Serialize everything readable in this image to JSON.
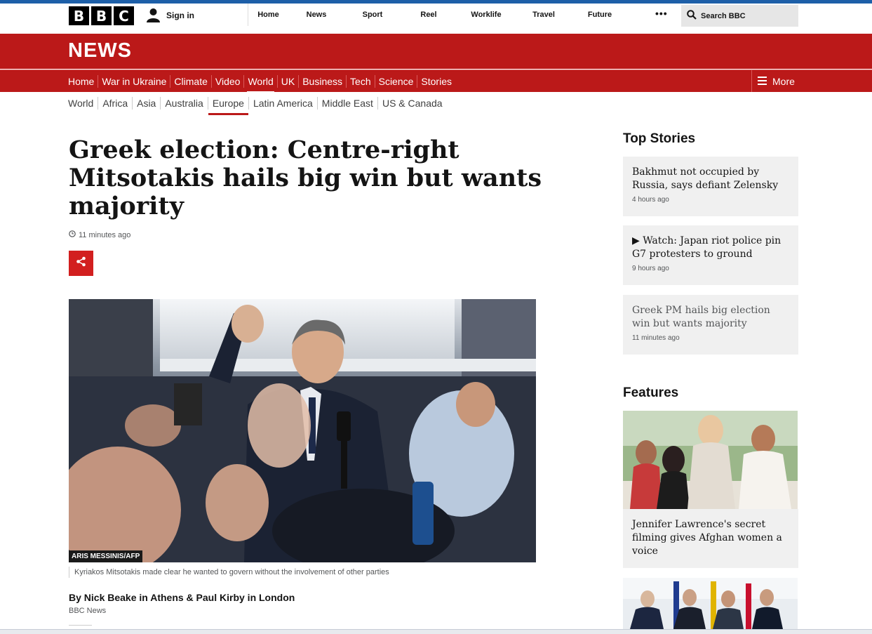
{
  "global": {
    "logo_letters": [
      "B",
      "B",
      "C"
    ],
    "signin_label": "Sign in",
    "nav": [
      "Home",
      "News",
      "Sport",
      "Reel",
      "Worklife",
      "Travel",
      "Future"
    ],
    "more_label": "•••",
    "search_label": "Search BBC"
  },
  "news": {
    "title": "NEWS",
    "nav": [
      "Home",
      "War in Ukraine",
      "Climate",
      "Video",
      "World",
      "UK",
      "Business",
      "Tech",
      "Science",
      "Stories"
    ],
    "active_nav": "World",
    "more_label": "More",
    "subnav": [
      "World",
      "Africa",
      "Asia",
      "Australia",
      "Europe",
      "Latin America",
      "Middle East",
      "US & Canada"
    ],
    "active_subnav": "Europe"
  },
  "article": {
    "headline": "Greek election: Centre-right Mitsotakis hails big win but wants majority",
    "timestamp": "11 minutes ago",
    "image_credit": "ARIS MESSINIS/AFP",
    "caption": "Kyriakos Mitsotakis made clear he wanted to govern without the involvement of other parties",
    "byline": "By Nick Beake in Athens & Paul Kirby in London",
    "byline_org": "BBC News"
  },
  "sidebar": {
    "top_stories_title": "Top Stories",
    "top_stories": [
      {
        "title": "Bakhmut not occupied by Russia, says defiant Zelensky",
        "time": "4 hours ago"
      },
      {
        "title": "▶ Watch: Japan riot police pin G7 protesters to ground",
        "time": "9 hours ago"
      },
      {
        "title": "Greek PM hails big election win but wants majority",
        "time": "11 minutes ago"
      }
    ],
    "features_title": "Features",
    "feature_story": "Jennifer Lawrence's secret filming gives Afghan women a voice"
  },
  "colors": {
    "bbc_red": "#bb1919",
    "share_red": "#d21f1f",
    "top_strip": "#1d5fa8",
    "card_bg": "#f0f0f0"
  }
}
